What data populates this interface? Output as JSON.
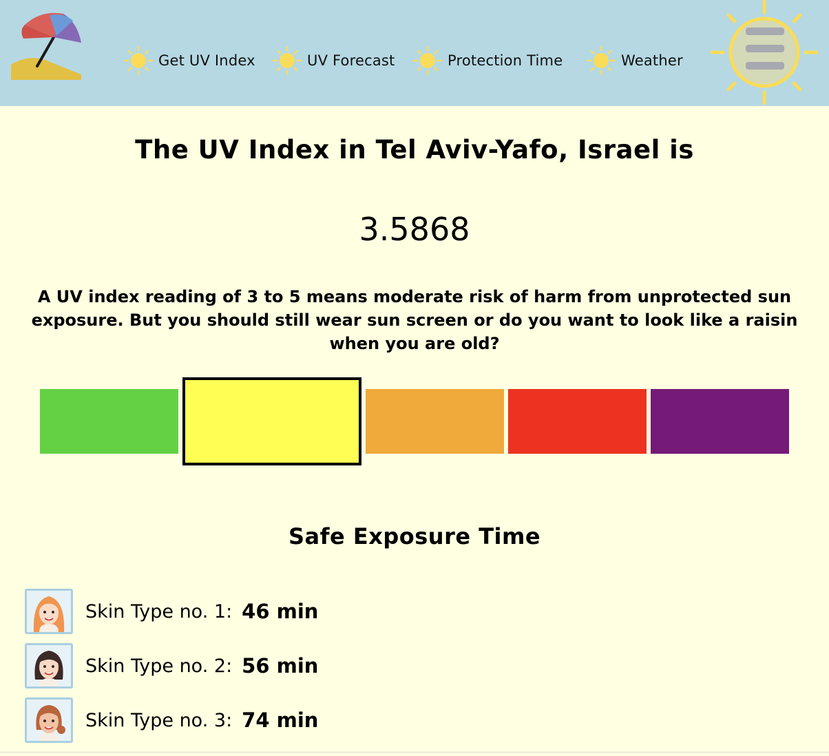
{
  "nav": {
    "items": [
      {
        "label": "Get UV Index",
        "icon": "sun-icon"
      },
      {
        "label": "UV Forecast",
        "icon": "sun-icon"
      },
      {
        "label": "Protection Time",
        "icon": "sun-icon"
      },
      {
        "label": "Weather",
        "icon": "sun-icon"
      }
    ],
    "menu_icon": "sun-menu-icon",
    "logo_icon": "beach-umbrella-icon"
  },
  "main": {
    "title": "The UV Index in Tel Aviv-Yafo, Israel is",
    "uv_value": "3.5868",
    "description": "A UV index reading of 3 to 5 means moderate risk of harm from unprotected sun exposure. But you should still wear sun screen or do you want to look like a raisin when you are old?"
  },
  "uv_scale": {
    "segments": [
      {
        "level": "low",
        "color": "#64d144"
      },
      {
        "level": "moderate",
        "color": "#fffe55"
      },
      {
        "level": "high",
        "color": "#f0a93b"
      },
      {
        "level": "very-high",
        "color": "#ec3322"
      },
      {
        "level": "extreme",
        "color": "#751a77"
      }
    ],
    "current_index": 1
  },
  "safe_exposure": {
    "title": "Safe Exposure Time",
    "rows": [
      {
        "label": "Skin Type no. 1:",
        "value": "46 min",
        "avatar": "avatar-skin-type-1-icon"
      },
      {
        "label": "Skin Type no. 2:",
        "value": "56 min",
        "avatar": "avatar-skin-type-2-icon"
      },
      {
        "label": "Skin Type no. 3:",
        "value": "74 min",
        "avatar": "avatar-skin-type-3-icon"
      }
    ]
  },
  "colors": {
    "header_bg": "#b5d8e3",
    "page_bg": "#ffffe1",
    "sun_yellow": "#fbdc58"
  }
}
